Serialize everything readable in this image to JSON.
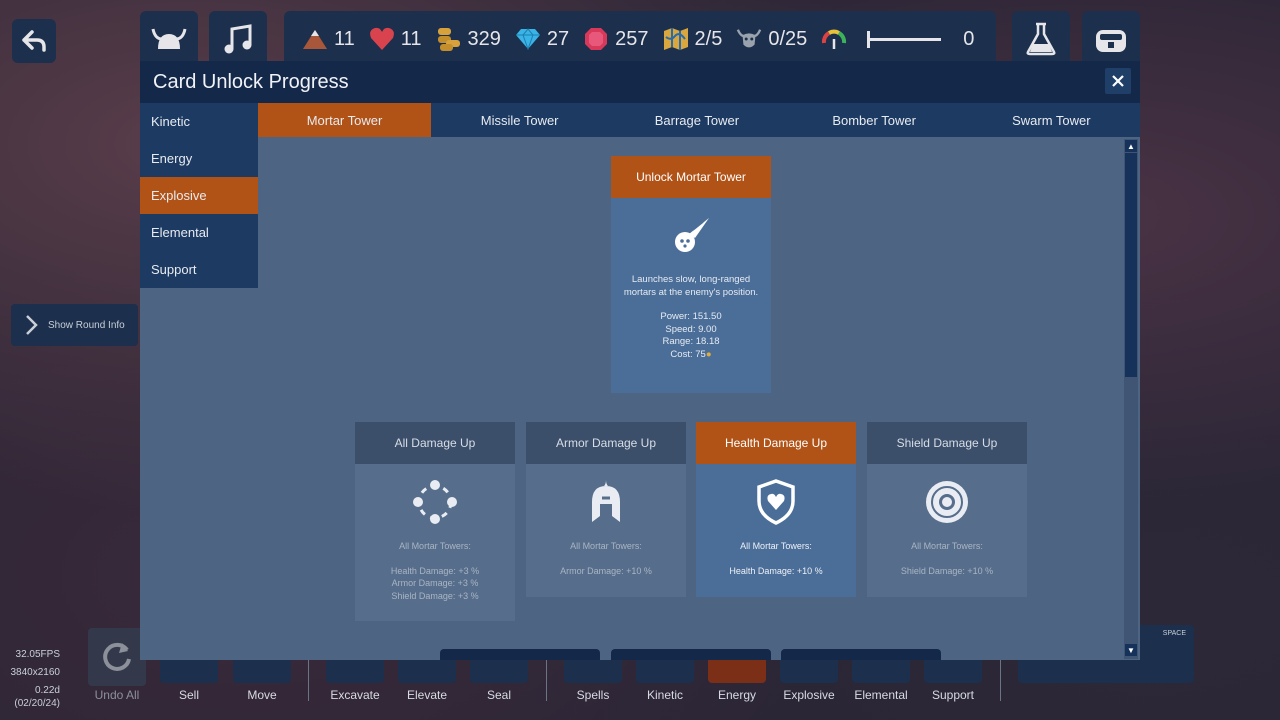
{
  "resources": [
    {
      "icon": "mountain-icon",
      "value": "11"
    },
    {
      "icon": "heart-icon",
      "value": "11"
    },
    {
      "icon": "coins-icon",
      "value": "329"
    },
    {
      "icon": "diamond-icon",
      "value": "27"
    },
    {
      "icon": "gem-icon",
      "value": "257"
    },
    {
      "icon": "map-icon",
      "value": "2/5"
    },
    {
      "icon": "monster-icon",
      "value": "0/25"
    }
  ],
  "slider_value": "0",
  "side_info": {
    "label": "Show Round Info"
  },
  "stats": {
    "fps": "32.05FPS",
    "resolution": "3840x2160",
    "version": "0.22d",
    "date": "(02/20/24)"
  },
  "bottom_bar": {
    "undo_label": "Undo All",
    "items": [
      "Sell",
      "Move",
      "Excavate",
      "Elevate",
      "Seal",
      "Spells",
      "Kinetic",
      "Energy",
      "Explosive",
      "Elemental",
      "Support"
    ],
    "space_key": "SPACE"
  },
  "modal": {
    "title": "Card Unlock Progress",
    "categories": [
      "Kinetic",
      "Energy",
      "Explosive",
      "Elemental",
      "Support"
    ],
    "active_category": "Explosive",
    "tabs": [
      "Mortar Tower",
      "Missile Tower",
      "Barrage Tower",
      "Bomber Tower",
      "Swarm Tower"
    ],
    "active_tab": "Mortar Tower",
    "main_card": {
      "header": "Unlock Mortar Tower",
      "description": "Launches slow, long-ranged mortars at the enemy's position.",
      "power": "Power: 151.50",
      "speed": "Speed: 9.00",
      "range": "Range: 18.18",
      "cost": "Cost: 75"
    },
    "upgrades": [
      {
        "title": "All Damage Up",
        "icon": "dots-circle-icon",
        "subtitle": "All Mortar Towers:",
        "lines": [
          "Health Damage: +3 %",
          "Armor Damage: +3 %",
          "Shield Damage: +3 %"
        ]
      },
      {
        "title": "Armor Damage Up",
        "icon": "helmet-icon",
        "subtitle": "All Mortar Towers:",
        "lines": [
          "Armor Damage: +10 %"
        ]
      },
      {
        "title": "Health Damage Up",
        "icon": "heart-shield-icon",
        "subtitle": "All Mortar Towers:",
        "lines": [
          "Health Damage: +10 %"
        ]
      },
      {
        "title": "Shield Damage Up",
        "icon": "round-shield-icon",
        "subtitle": "All Mortar Towers:",
        "lines": [
          "Shield Damage: +10 %"
        ]
      }
    ]
  },
  "colors": {
    "accent": "#b15317",
    "panel": "#1c3a62",
    "modal_bg": "#4d6483"
  }
}
